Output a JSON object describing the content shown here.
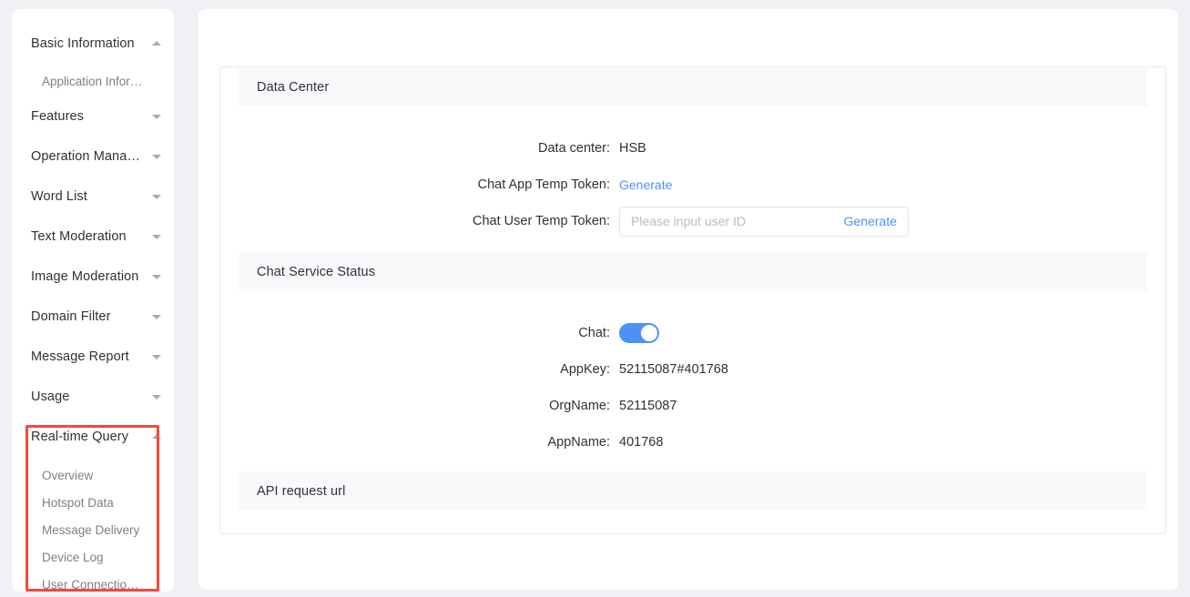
{
  "sidebar": {
    "groups": [
      {
        "label": "Basic Information",
        "expanded": true,
        "caret": "caret-up-icon",
        "children": [
          {
            "label": "Application Infor…"
          }
        ]
      },
      {
        "label": "Features",
        "expanded": false,
        "caret": "caret-down-icon",
        "children": []
      },
      {
        "label": "Operation Manag…",
        "expanded": false,
        "caret": "caret-down-icon",
        "children": []
      },
      {
        "label": "Word List",
        "expanded": false,
        "caret": "caret-down-icon",
        "children": []
      },
      {
        "label": "Text Moderation",
        "expanded": false,
        "caret": "caret-down-icon",
        "children": []
      },
      {
        "label": "Image Moderation",
        "expanded": false,
        "caret": "caret-down-icon",
        "children": []
      },
      {
        "label": "Domain Filter",
        "expanded": false,
        "caret": "caret-down-icon",
        "children": []
      },
      {
        "label": "Message Report",
        "expanded": false,
        "caret": "caret-down-icon",
        "children": []
      },
      {
        "label": "Usage",
        "expanded": false,
        "caret": "caret-down-icon",
        "children": []
      },
      {
        "label": "Real-time Query",
        "expanded": true,
        "caret": "caret-up-icon",
        "children": [
          {
            "label": "Overview"
          },
          {
            "label": "Hotspot Data"
          },
          {
            "label": "Message Delivery"
          },
          {
            "label": "Device Log"
          },
          {
            "label": "User Connectio…"
          }
        ]
      }
    ],
    "highlight_color": "#f5483b"
  },
  "main": {
    "sections": [
      {
        "title": "Data Center",
        "rows": [
          {
            "label": "Data center:",
            "value": "HSB",
            "type": "text"
          },
          {
            "label": "Chat App Temp Token:",
            "value": "Generate",
            "type": "link"
          },
          {
            "label": "Chat User Temp Token:",
            "type": "input",
            "placeholder": "Please input user ID",
            "value": "",
            "action_label": "Generate"
          }
        ]
      },
      {
        "title": "Chat Service Status",
        "rows": [
          {
            "label": "Chat:",
            "type": "toggle",
            "value": "on"
          },
          {
            "label": "AppKey:",
            "value": "52115087#401768",
            "type": "text"
          },
          {
            "label": "OrgName:",
            "value": "52115087",
            "type": "text"
          },
          {
            "label": "AppName:",
            "value": "401768",
            "type": "text"
          }
        ]
      },
      {
        "title": "API request url",
        "rows": []
      }
    ]
  },
  "colors": {
    "accent": "#4b92f7",
    "page_bg": "#eff1f5",
    "section_bg": "#f8f9fb",
    "text_primary": "#2f3135",
    "text_secondary": "#7b7f87",
    "highlight": "#f5483b"
  }
}
